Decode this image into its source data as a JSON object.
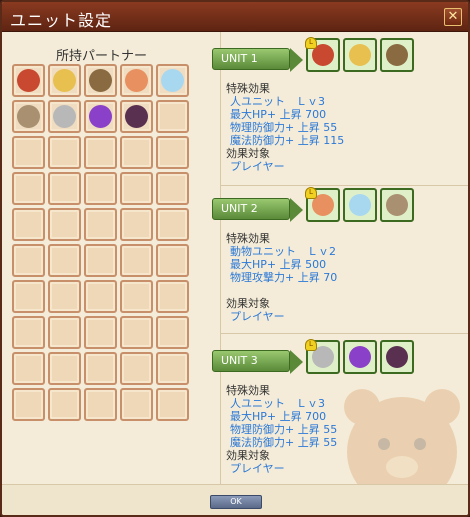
{
  "window": {
    "title": "ユニット設定",
    "close_label": "✕",
    "ok_label": "OK"
  },
  "partners": {
    "title": "所持パートナー",
    "slots": [
      {
        "icon": "axe-warrior-icon",
        "color": "#c84830"
      },
      {
        "icon": "blonde-girl-icon",
        "color": "#e8c050"
      },
      {
        "icon": "brown-hood-girl-icon",
        "color": "#8a6a40"
      },
      {
        "icon": "bear-ears-girl-icon",
        "color": "#e89060"
      },
      {
        "icon": "ice-fairy-icon",
        "color": "#a8d8f0"
      },
      {
        "icon": "cat-prince-icon",
        "color": "#a89070"
      },
      {
        "icon": "silver-haired-girl-icon",
        "color": "#b8b8b8"
      },
      {
        "icon": "purple-dragon-icon",
        "color": "#8a40c8"
      },
      {
        "icon": "dark-haired-girl-icon",
        "color": "#5a3050"
      }
    ],
    "total_slots": 50
  },
  "units": [
    {
      "name": "UNIT 1",
      "members": [
        {
          "icon": "axe-warrior-icon",
          "color": "#c84830",
          "leader": true
        },
        {
          "icon": "blonde-girl-icon",
          "color": "#e8c050",
          "leader": false
        },
        {
          "icon": "brown-hood-girl-icon",
          "color": "#8a6a40",
          "leader": false
        }
      ],
      "effect_label": "特殊効果",
      "effects": [
        "人ユニット　Ｌｖ3",
        "最大HP+ 上昇 700",
        "物理防御力+ 上昇 55",
        "魔法防御力+ 上昇 115"
      ],
      "target_label": "効果対象",
      "target": "プレイヤー"
    },
    {
      "name": "UNIT 2",
      "members": [
        {
          "icon": "bear-ears-girl-icon",
          "color": "#e89060",
          "leader": true
        },
        {
          "icon": "ice-fairy-icon",
          "color": "#a8d8f0",
          "leader": false
        },
        {
          "icon": "cat-prince-icon",
          "color": "#a89070",
          "leader": false
        }
      ],
      "effect_label": "特殊効果",
      "effects": [
        "動物ユニット　Ｌｖ2",
        "最大HP+ 上昇 500",
        "物理攻撃力+ 上昇 70"
      ],
      "target_label": "効果対象",
      "target": "プレイヤー"
    },
    {
      "name": "UNIT 3",
      "members": [
        {
          "icon": "silver-haired-girl-icon",
          "color": "#b8b8b8",
          "leader": true
        },
        {
          "icon": "purple-dragon-icon",
          "color": "#8a40c8",
          "leader": false
        },
        {
          "icon": "dark-haired-girl-icon",
          "color": "#5a3050",
          "leader": false
        }
      ],
      "effect_label": "特殊効果",
      "effects": [
        "人ユニット　Ｌｖ3",
        "最大HP+ 上昇 700",
        "物理防御力+ 上昇 55",
        "魔法防御力+ 上昇 55"
      ],
      "target_label": "効果対象",
      "target": "プレイヤー"
    }
  ]
}
